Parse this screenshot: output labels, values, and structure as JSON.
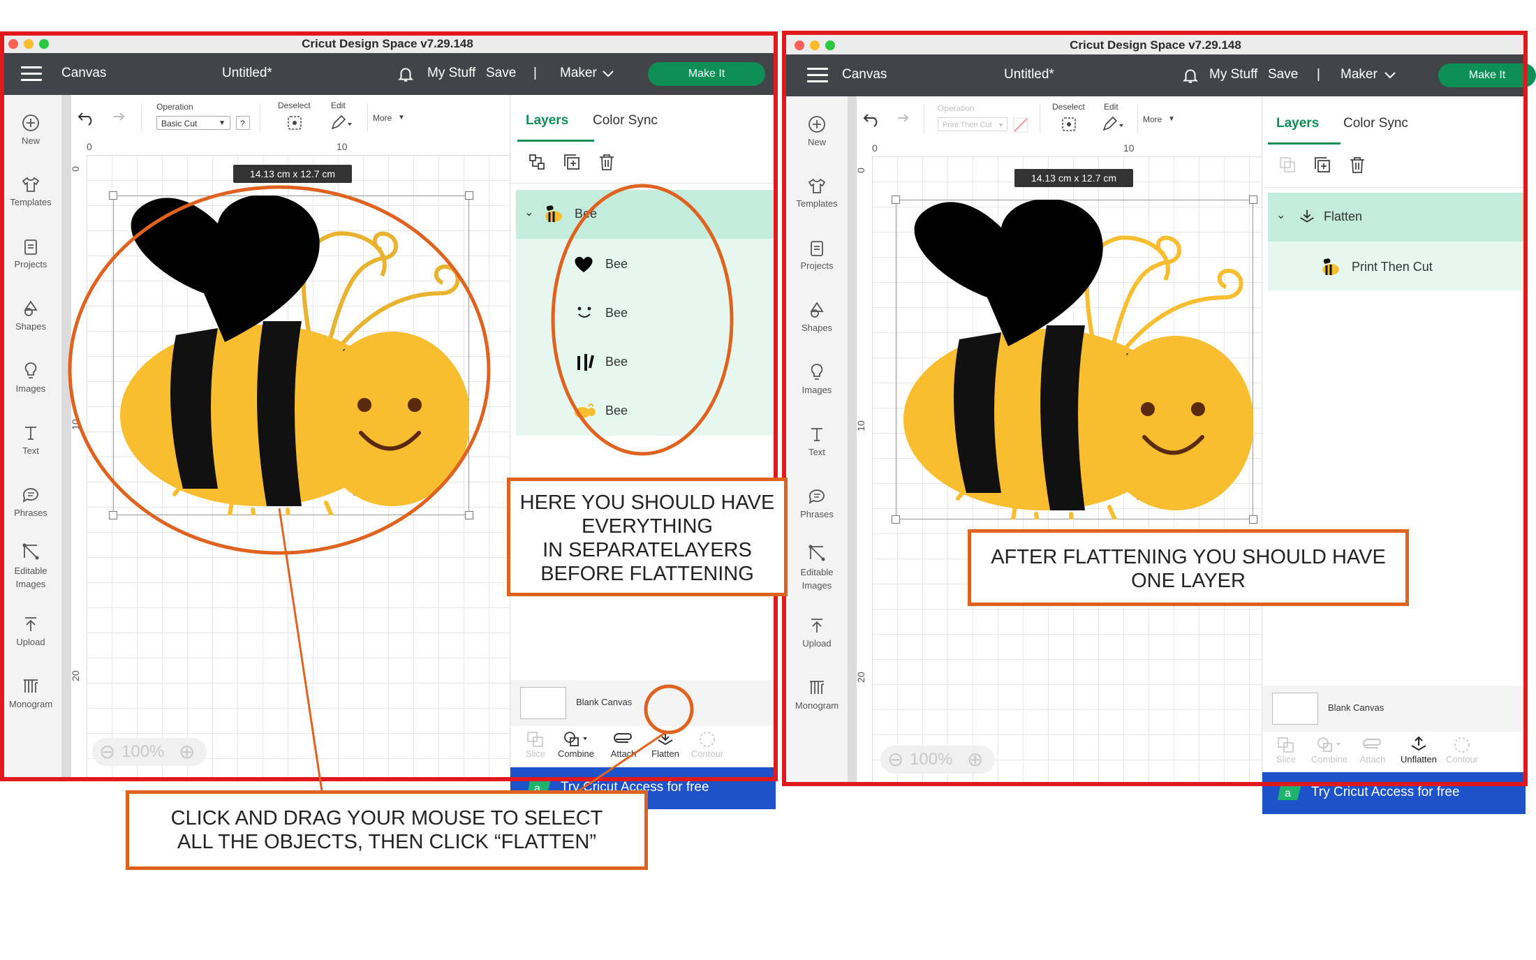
{
  "left": {
    "window_title": "Cricut Design Space  v7.29.148",
    "appbar": {
      "canvas": "Canvas",
      "doc": "Untitled*",
      "mystuff": "My Stuff",
      "save": "Save",
      "divider": "|",
      "machine": "Maker",
      "makeit": "Make It"
    },
    "sidebar": [
      "New",
      "Templates",
      "Projects",
      "Shapes",
      "Images",
      "Text",
      "Phrases",
      "Editable Images",
      "Upload",
      "Monogram"
    ],
    "toolbar": {
      "operation_label": "Operation",
      "operation_value": "Basic Cut",
      "help": "?",
      "deselect": "Deselect",
      "edit": "Edit",
      "more": "More"
    },
    "ruler": {
      "x0": "0",
      "x10": "10",
      "y0": "0",
      "y10": "10",
      "y20": "20"
    },
    "size": "14.13  cm x 12.7  cm",
    "zoom": "100%",
    "tabs": {
      "layers": "Layers",
      "colorsync": "Color Sync"
    },
    "layers": {
      "group": "Bee",
      "children": [
        "Bee",
        "Bee",
        "Bee",
        "Bee"
      ]
    },
    "blank_canvas": "Blank Canvas",
    "tools": [
      "Slice",
      "Combine",
      "Attach",
      "Flatten",
      "Contour"
    ],
    "access": "Try Cricut Access for free"
  },
  "right": {
    "window_title": "Cricut Design Space  v7.29.148",
    "appbar": {
      "canvas": "Canvas",
      "doc": "Untitled*",
      "mystuff": "My Stuff",
      "save": "Save",
      "divider": "|",
      "machine": "Maker",
      "makeit": "Make It"
    },
    "sidebar": [
      "New",
      "Templates",
      "Projects",
      "Shapes",
      "Images",
      "Text",
      "Phrases",
      "Editable Images",
      "Upload",
      "Monogram"
    ],
    "toolbar": {
      "operation_label": "Operation",
      "operation_value": "Print Then Cut",
      "deselect": "Deselect",
      "edit": "Edit",
      "more": "More"
    },
    "ruler": {
      "x0": "0",
      "x10": "10",
      "y0": "0",
      "y10": "10",
      "y20": "20"
    },
    "size": "14.13  cm x 12.7  cm",
    "zoom": "100%",
    "tabs": {
      "layers": "Layers",
      "colorsync": "Color Sync"
    },
    "layers": {
      "group": "Flatten",
      "child": "Print Then Cut"
    },
    "blank_canvas": "Blank Canvas",
    "tools": [
      "Slice",
      "Combine",
      "Attach",
      "Unflatten",
      "Contour"
    ],
    "access": "Try Cricut Access for free"
  },
  "callouts": {
    "separate": [
      "HERE YOU SHOULD HAVE",
      "EVERYTHING",
      "IN SEPARATELAYERS",
      "BEFORE FLATTENING"
    ],
    "after": [
      "AFTER FLATTENING YOU SHOULD HAVE",
      "ONE LAYER"
    ],
    "drag": [
      "CLICK AND DRAG YOUR MOUSE TO SELECT",
      "ALL THE OBJECTS, THEN CLICK “FLATTEN”"
    ]
  },
  "colors": {
    "frame": "#e1191c",
    "annotation": "#e0621f",
    "bee_yellow": "#f9be2f",
    "make_it": "#0e8f56",
    "layer_selected": "#c4ecdc",
    "access_blue": "#1e52c8"
  }
}
